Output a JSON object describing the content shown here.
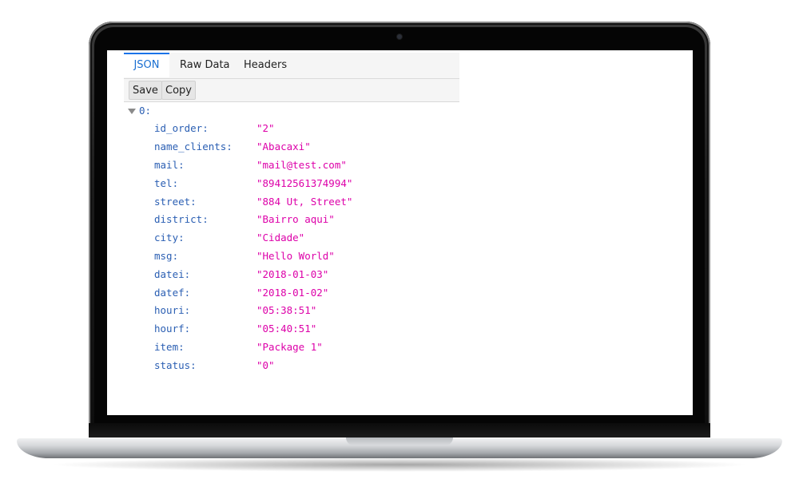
{
  "tabs": [
    {
      "label": "JSON",
      "active": true
    },
    {
      "label": "Raw Data",
      "active": false
    },
    {
      "label": "Headers",
      "active": false
    }
  ],
  "toolbar": {
    "save_label": "Save",
    "copy_label": "Copy"
  },
  "tree": {
    "root_label": "0:",
    "twisty_icon": "triangle-down-icon",
    "rows": [
      {
        "key": "id_order:",
        "value": "\"2\""
      },
      {
        "key": "name_clients:",
        "value": "\"Abacaxi\""
      },
      {
        "key": "mail:",
        "value": "\"mail@test.com\""
      },
      {
        "key": "tel:",
        "value": "\"89412561374994\""
      },
      {
        "key": "street:",
        "value": "\"884 Ut, Street\""
      },
      {
        "key": "district:",
        "value": "\"Bairro aqui\""
      },
      {
        "key": "city:",
        "value": "\"Cidade\""
      },
      {
        "key": "msg:",
        "value": "\"Hello World\""
      },
      {
        "key": "datei:",
        "value": "\"2018-01-03\""
      },
      {
        "key": "datef:",
        "value": "\"2018-01-02\""
      },
      {
        "key": "houri:",
        "value": "\"05:38:51\""
      },
      {
        "key": "hourf:",
        "value": "\"05:40:51\""
      },
      {
        "key": "item:",
        "value": "\"Package 1\""
      },
      {
        "key": "status:",
        "value": "\"0\""
      }
    ]
  },
  "colors": {
    "key": "#2b5fb3",
    "string_value": "#dd00a9",
    "active_tab": "#1a73e8"
  }
}
